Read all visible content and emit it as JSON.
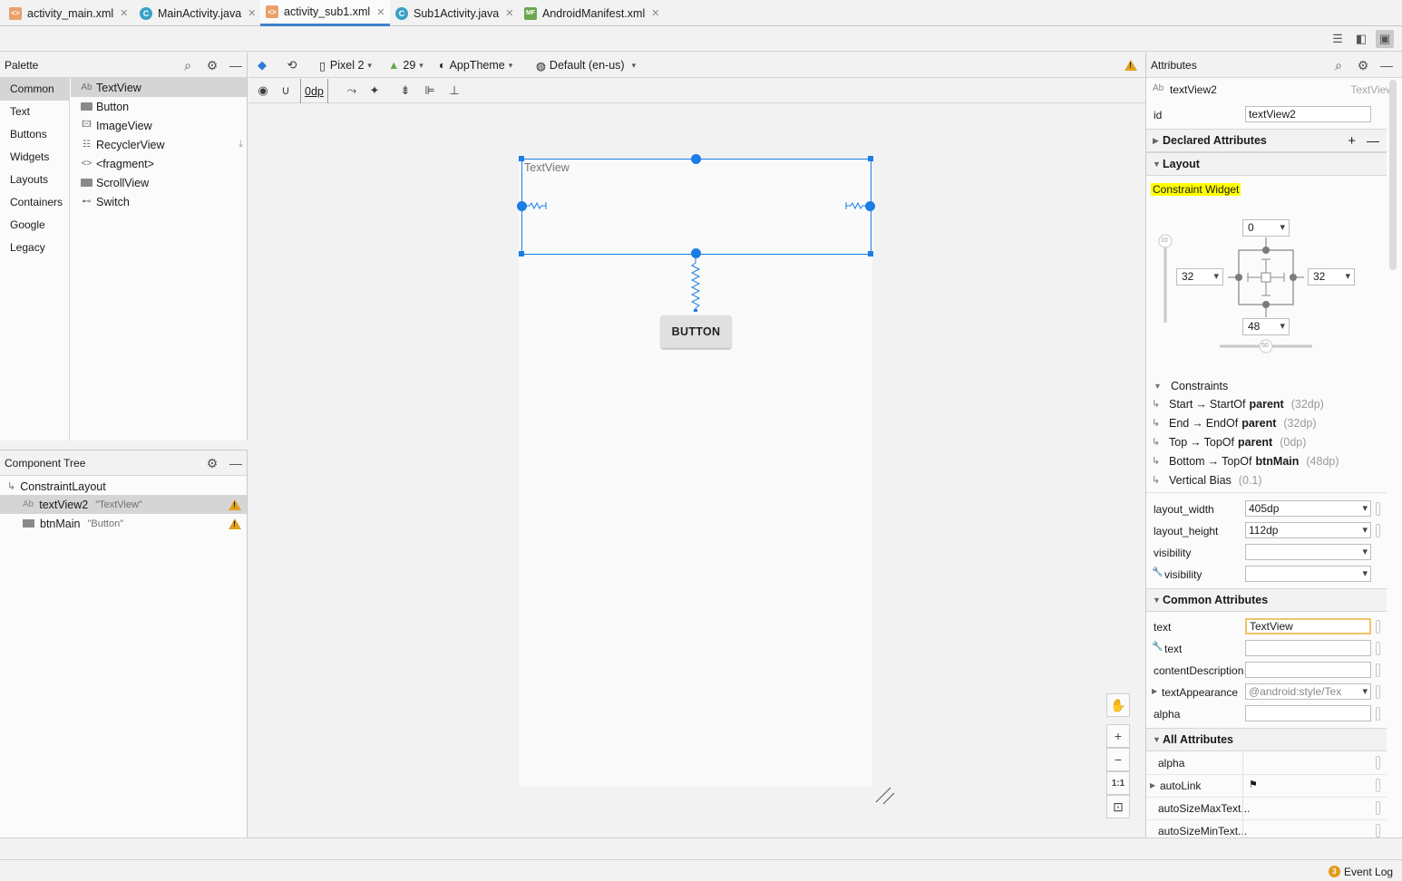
{
  "tabs": [
    {
      "label": "activity_main.xml",
      "icon": "xml-file-icon"
    },
    {
      "label": "MainActivity.java",
      "icon": "java-class-icon"
    },
    {
      "label": "activity_sub1.xml",
      "icon": "xml-file-icon",
      "active": true
    },
    {
      "label": "Sub1Activity.java",
      "icon": "java-class-icon"
    },
    {
      "label": "AndroidManifest.xml",
      "icon": "manifest-file-icon"
    }
  ],
  "palette": {
    "title": "Palette",
    "categories": [
      "Common",
      "Text",
      "Buttons",
      "Widgets",
      "Layouts",
      "Containers",
      "Google",
      "Legacy"
    ],
    "items": [
      {
        "label": "TextView",
        "icon": "Ab"
      },
      {
        "label": "Button"
      },
      {
        "label": "ImageView"
      },
      {
        "label": "RecyclerView"
      },
      {
        "label": "<fragment>",
        "icon": "<>"
      },
      {
        "label": "ScrollView"
      },
      {
        "label": "Switch"
      }
    ]
  },
  "component_tree": {
    "title": "Component Tree",
    "root": "ConstraintLayout",
    "children": [
      {
        "name": "textView2",
        "sub": "\"TextView\"",
        "icon": "Ab"
      },
      {
        "name": "btnMain",
        "sub": "\"Button\""
      }
    ]
  },
  "design_toolbar": {
    "device": "Pixel 2",
    "api": "29",
    "theme": "AppTheme",
    "locale": "Default (en-us)",
    "margin": "0dp"
  },
  "canvas": {
    "textview_text": "TextView",
    "button_text": "BUTTON",
    "zoom_fit": "1:1"
  },
  "attributes": {
    "title": "Attributes",
    "selected_type_icon": "Ab",
    "selected_name": "textView2",
    "selected_type": "TextView",
    "id_label": "id",
    "id_value": "textView2",
    "sections": {
      "declared": "Declared Attributes",
      "layout": "Layout",
      "common": "Common Attributes",
      "all": "All Attributes"
    },
    "constraint_widget_label": "Constraint Widget",
    "constraint_widget": {
      "top": "0",
      "left": "32",
      "right": "32",
      "bottom": "48",
      "vertical_bias": "10",
      "horizontal_bias": "50"
    },
    "constraints_title": "Constraints",
    "constraints": [
      {
        "from": "Start",
        "arrow": "→",
        "to": "StartOf",
        "target": "parent",
        "value": "(32dp)"
      },
      {
        "from": "End",
        "arrow": "→",
        "to": "EndOf",
        "target": "parent",
        "value": "(32dp)"
      },
      {
        "from": "Top",
        "arrow": "→",
        "to": "TopOf",
        "target": "parent",
        "value": "(0dp)"
      },
      {
        "from": "Bottom",
        "arrow": "→",
        "to": "TopOf",
        "target": "btnMain",
        "value": "(48dp)"
      },
      {
        "from": "Vertical Bias",
        "arrow": "",
        "to": "",
        "target": "",
        "value": "(0.1)"
      }
    ],
    "layout_rows": [
      {
        "label": "layout_width",
        "value": "405dp"
      },
      {
        "label": "layout_height",
        "value": "112dp"
      },
      {
        "label": "visibility",
        "value": ""
      },
      {
        "label": "visibility",
        "value": "",
        "tool": true
      }
    ],
    "common_rows": [
      {
        "label": "text",
        "value": "TextView"
      },
      {
        "label": "text",
        "value": "",
        "tool": true
      },
      {
        "label": "contentDescription",
        "value": ""
      },
      {
        "label": "textAppearance",
        "value": "@android:style/Tex"
      },
      {
        "label": "alpha",
        "value": ""
      }
    ],
    "all_rows": [
      {
        "label": "alpha",
        "value": ""
      },
      {
        "label": "autoLink",
        "value": ""
      },
      {
        "label": "autoSizeMaxText...",
        "value": ""
      },
      {
        "label": "autoSizeMinText...",
        "value": ""
      }
    ]
  },
  "status": {
    "event_count": "3",
    "event_log": "Event Log"
  },
  "colors": {
    "accent": "#1a7de5",
    "highlight": "#ffff00",
    "warning": "#e0a11b"
  }
}
